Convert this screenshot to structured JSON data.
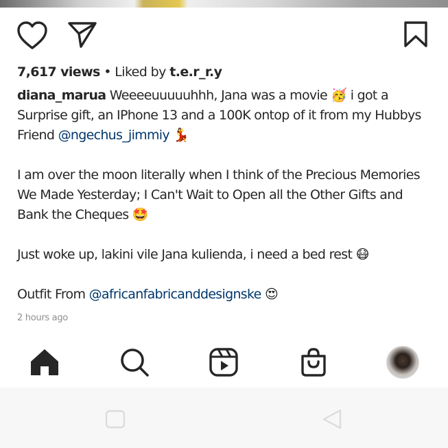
{
  "post": {
    "views_count": "7,617 views",
    "separator": "•",
    "liked_by_prefix": "Liked by",
    "liked_by_user": "t.e.r_r.y",
    "caption": {
      "username": "diana_marua",
      "line1": "Weeeeuuuuuhhh, Jana was a movie",
      "line1_emoji": "🥳",
      "line1b": "i got a Surprise gift, an IPhone 13 and a 100K ontop of it from my Hubbys Friend",
      "mention1": "@ngechus_jimmiy",
      "mention1_emoji": "💃",
      "para2": "I am over the moon literally when I think of the Precious Memories We Made Yesterday; I Can't Wait to Open all the Other Gifts and Bank the Cheques",
      "para2_emoji": "🤩",
      "para3": "Just woke up, lakini vile Jana kulienda, i need a bed rest",
      "para3_emoji": "😷",
      "para4": "Outfit From",
      "mention2": "@africanfabricanddesignske",
      "para4_emoji": "😍"
    },
    "timestamp": "2 hours ago"
  },
  "actions": {
    "like_icon": "heart-icon",
    "share_icon": "send-icon",
    "save_icon": "bookmark-icon"
  },
  "bottom_nav": {
    "items": [
      "home-icon",
      "search-icon",
      "reels-icon",
      "shop-icon",
      "profile-avatar"
    ]
  },
  "system_nav": {
    "items": [
      "recents-button",
      "back-button"
    ]
  },
  "colors": {
    "text": "#262626",
    "link": "#00376b",
    "muted": "#8e8e8e",
    "icon": "#262626"
  }
}
